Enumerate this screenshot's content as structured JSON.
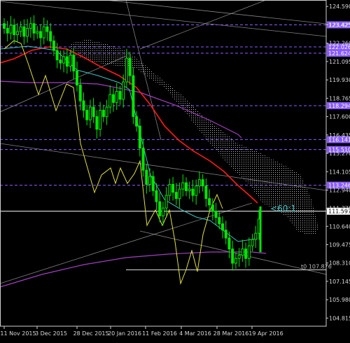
{
  "chart_data": {
    "type": "line",
    "x_tick_labels": [
      "11 Nov 2015",
      "3 Dec 2015",
      "28 Dec 2015",
      "20 Jan 2016",
      "11 Feb 2016",
      "4 Mar 2016",
      "28 Mar 2016",
      "19 Apr 2016"
    ],
    "y_tick_labels": [
      "124.590",
      "123.425",
      "122.260",
      "121.095",
      "119.930",
      "118.765",
      "117.600",
      "116.435",
      "115.270",
      "114.105",
      "112.940",
      "111.775",
      "110.640",
      "109.475",
      "108.310",
      "107.145",
      "105.980",
      "104.815"
    ],
    "ylim": [
      104.3,
      125.0
    ],
    "colors": {
      "price": "#00e600",
      "red_ma": "#ff1a1a",
      "cyan_ma": "#40c0c0",
      "purple_ma": "#a040c0",
      "lagging": "#e0e040",
      "cloud": "#c8c8c8",
      "level": "#8a5cff",
      "trend": "#b0b0b0"
    },
    "level_tags": [
      {
        "value": 123.425,
        "label": "123.425",
        "color": "#8a5cff"
      },
      {
        "value": 122.026,
        "label": "122.026",
        "color": "#8a5cff"
      },
      {
        "value": 121.624,
        "label": "121.624",
        "color": "#8a5cff"
      },
      {
        "value": 118.294,
        "label": "118.294",
        "color": "#8a5cff"
      },
      {
        "value": 116.141,
        "label": "116.141",
        "color": "#8a5cff"
      },
      {
        "value": 115.51,
        "label": "115.510",
        "color": "#8a5cff"
      },
      {
        "value": 113.246,
        "label": "113.246",
        "color": "#8a5cff"
      },
      {
        "value": 111.597,
        "label": "111.597",
        "color": "#ffffff"
      }
    ],
    "annotation": "<60:1",
    "low_label": "t0 107.876",
    "low_value": 107.876,
    "price_close": [
      123.2,
      122.9,
      123.4,
      122.8,
      123.0,
      123.3,
      122.7,
      123.2,
      123.5,
      122.9,
      123.0,
      122.6,
      123.3,
      123.0,
      122.4,
      121.8,
      121.2,
      121.0,
      121.4,
      120.8,
      121.5,
      120.5,
      119.6,
      118.6,
      118.0,
      117.4,
      118.2,
      117.6,
      116.8,
      118.0,
      117.6,
      118.2,
      119.0,
      118.5,
      119.2,
      118.7,
      119.8,
      121.3,
      120.2,
      117.6,
      117.0,
      115.6,
      114.2,
      113.3,
      113.8,
      112.9,
      112.2,
      111.3,
      111.8,
      112.6,
      113.3,
      112.8,
      112.4,
      113.0,
      113.4,
      112.9,
      113.0,
      112.6,
      113.2,
      113.6,
      113.2,
      112.4,
      112.0,
      111.6,
      111.2,
      110.8,
      110.4,
      109.9,
      109.2,
      108.3,
      108.6,
      108.8,
      109.2,
      108.6,
      109.4,
      109.8,
      110.2,
      111.1
    ]
  }
}
